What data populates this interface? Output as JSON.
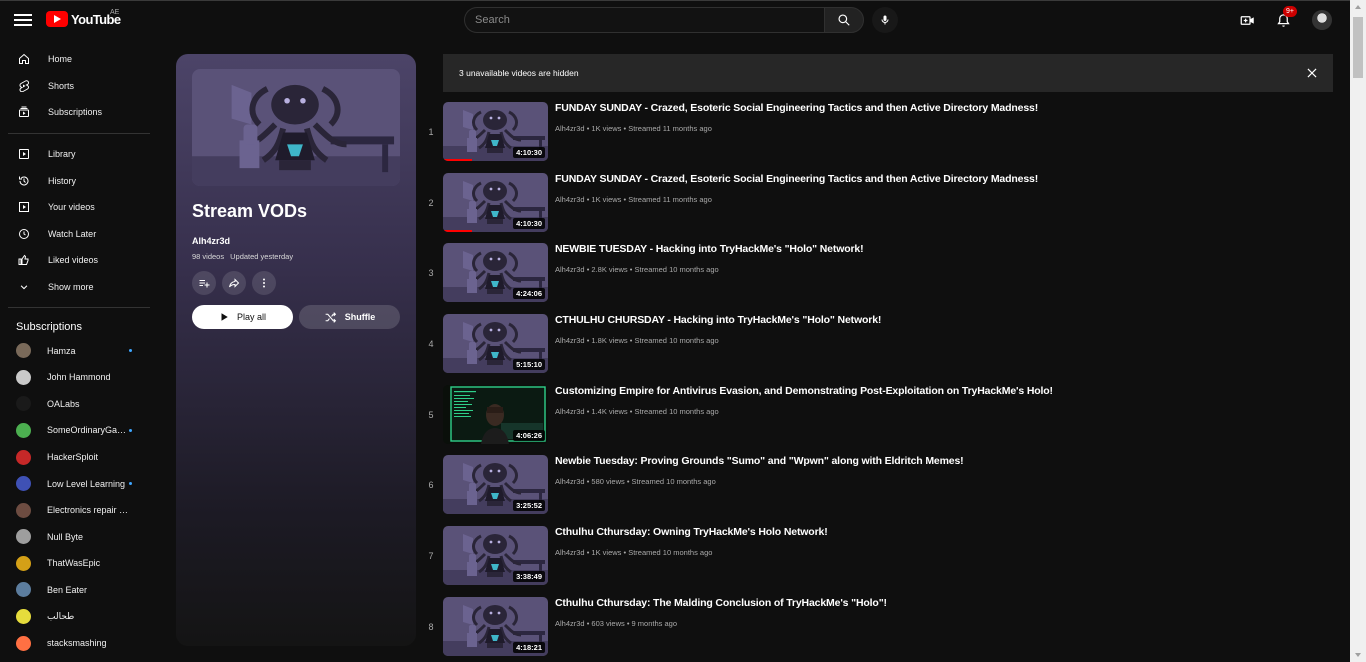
{
  "topbar": {
    "logo_text": "YouTube",
    "country_code": "AE",
    "search_placeholder": "Search",
    "notification_count": "9+"
  },
  "sidebar": {
    "main": [
      {
        "label": "Home",
        "icon": "home-icon"
      },
      {
        "label": "Shorts",
        "icon": "shorts-icon"
      },
      {
        "label": "Subscriptions",
        "icon": "subscriptions-icon"
      }
    ],
    "library": [
      {
        "label": "Library",
        "icon": "library-icon"
      },
      {
        "label": "History",
        "icon": "history-icon"
      },
      {
        "label": "Your videos",
        "icon": "your-videos-icon"
      },
      {
        "label": "Watch Later",
        "icon": "clock-icon"
      },
      {
        "label": "Liked videos",
        "icon": "thumbs-up-icon"
      },
      {
        "label": "Show more",
        "icon": "chevron-down-icon"
      }
    ],
    "subscriptions_header": "Subscriptions",
    "subscriptions": [
      {
        "name": "Hamza",
        "color": "#7a6a5a",
        "new": true
      },
      {
        "name": "John Hammond",
        "color": "#c9c9c9",
        "new": false
      },
      {
        "name": "OALabs",
        "color": "#1a1a1a",
        "new": false
      },
      {
        "name": "SomeOrdinaryGamers",
        "color": "#4caf50",
        "new": true
      },
      {
        "name": "HackerSploit",
        "color": "#c62828",
        "new": false
      },
      {
        "name": "Low Level Learning",
        "color": "#3f51b5",
        "new": true
      },
      {
        "name": "Electronics repair school",
        "color": "#6d4c41",
        "new": false
      },
      {
        "name": "Null Byte",
        "color": "#9e9e9e",
        "new": false
      },
      {
        "name": "ThatWasEpic",
        "color": "#d4a017",
        "new": false
      },
      {
        "name": "Ben Eater",
        "color": "#5c7d9e",
        "new": false
      },
      {
        "name": "طحالب",
        "color": "#e6dc3c",
        "new": false
      },
      {
        "name": "stacksmashing",
        "color": "#ff7043",
        "new": false
      }
    ]
  },
  "playlist": {
    "title": "Stream VODs",
    "owner": "Alh4zr3d",
    "video_count": "98 videos",
    "updated": "Updated yesterday",
    "play_all_label": "Play all",
    "shuffle_label": "Shuffle"
  },
  "banner": {
    "text": "3 unavailable videos are hidden"
  },
  "videos": [
    {
      "index": "1",
      "title": "FUNDAY SUNDAY - Crazed, Esoteric Social Engineering Tactics and then Active Directory Madness!",
      "channel": "Alh4zr3d",
      "meta": "1K views • Streamed 11 months ago",
      "duration": "4:10:30",
      "progress": 0.28,
      "thumb": "default"
    },
    {
      "index": "2",
      "title": "FUNDAY SUNDAY - Crazed, Esoteric Social Engineering Tactics and then Active Directory Madness!",
      "channel": "Alh4zr3d",
      "meta": "1K views • Streamed 11 months ago",
      "duration": "4:10:30",
      "progress": 0.28,
      "thumb": "default"
    },
    {
      "index": "3",
      "title": "NEWBIE TUESDAY - Hacking into TryHackMe's \"Holo\" Network!",
      "channel": "Alh4zr3d",
      "meta": "2.8K views • Streamed 10 months ago",
      "duration": "4:24:06",
      "progress": 0,
      "thumb": "default"
    },
    {
      "index": "4",
      "title": "CTHULHU CHURSDAY - Hacking into TryHackMe's \"Holo\" Network!",
      "channel": "Alh4zr3d",
      "meta": "1.8K views • Streamed 10 months ago",
      "duration": "5:15:10",
      "progress": 0,
      "thumb": "default"
    },
    {
      "index": "5",
      "title": "Customizing Empire for Antivirus Evasion, and Demonstrating Post-Exploitation on TryHackMe's Holo!",
      "channel": "Alh4zr3d",
      "meta": "1.4K views • Streamed 10 months ago",
      "duration": "4:06:26",
      "progress": 0,
      "thumb": "terminal"
    },
    {
      "index": "6",
      "title": "Newbie Tuesday: Proving Grounds \"Sumo\" and \"Wpwn\" along with Eldritch Memes!",
      "channel": "Alh4zr3d",
      "meta": "580 views • Streamed 10 months ago",
      "duration": "3:25:52",
      "progress": 0,
      "thumb": "default"
    },
    {
      "index": "7",
      "title": "Cthulhu Cthursday: Owning TryHackMe's Holo Network!",
      "channel": "Alh4zr3d",
      "meta": "1K views • Streamed 10 months ago",
      "duration": "3:38:49",
      "progress": 0,
      "thumb": "default"
    },
    {
      "index": "8",
      "title": "Cthulhu Cthursday: The Malding Conclusion of TryHackMe's \"Holo\"!",
      "channel": "Alh4zr3d",
      "meta": "603 views • 9 months ago",
      "duration": "4:18:21",
      "progress": 0,
      "thumb": "default"
    }
  ]
}
